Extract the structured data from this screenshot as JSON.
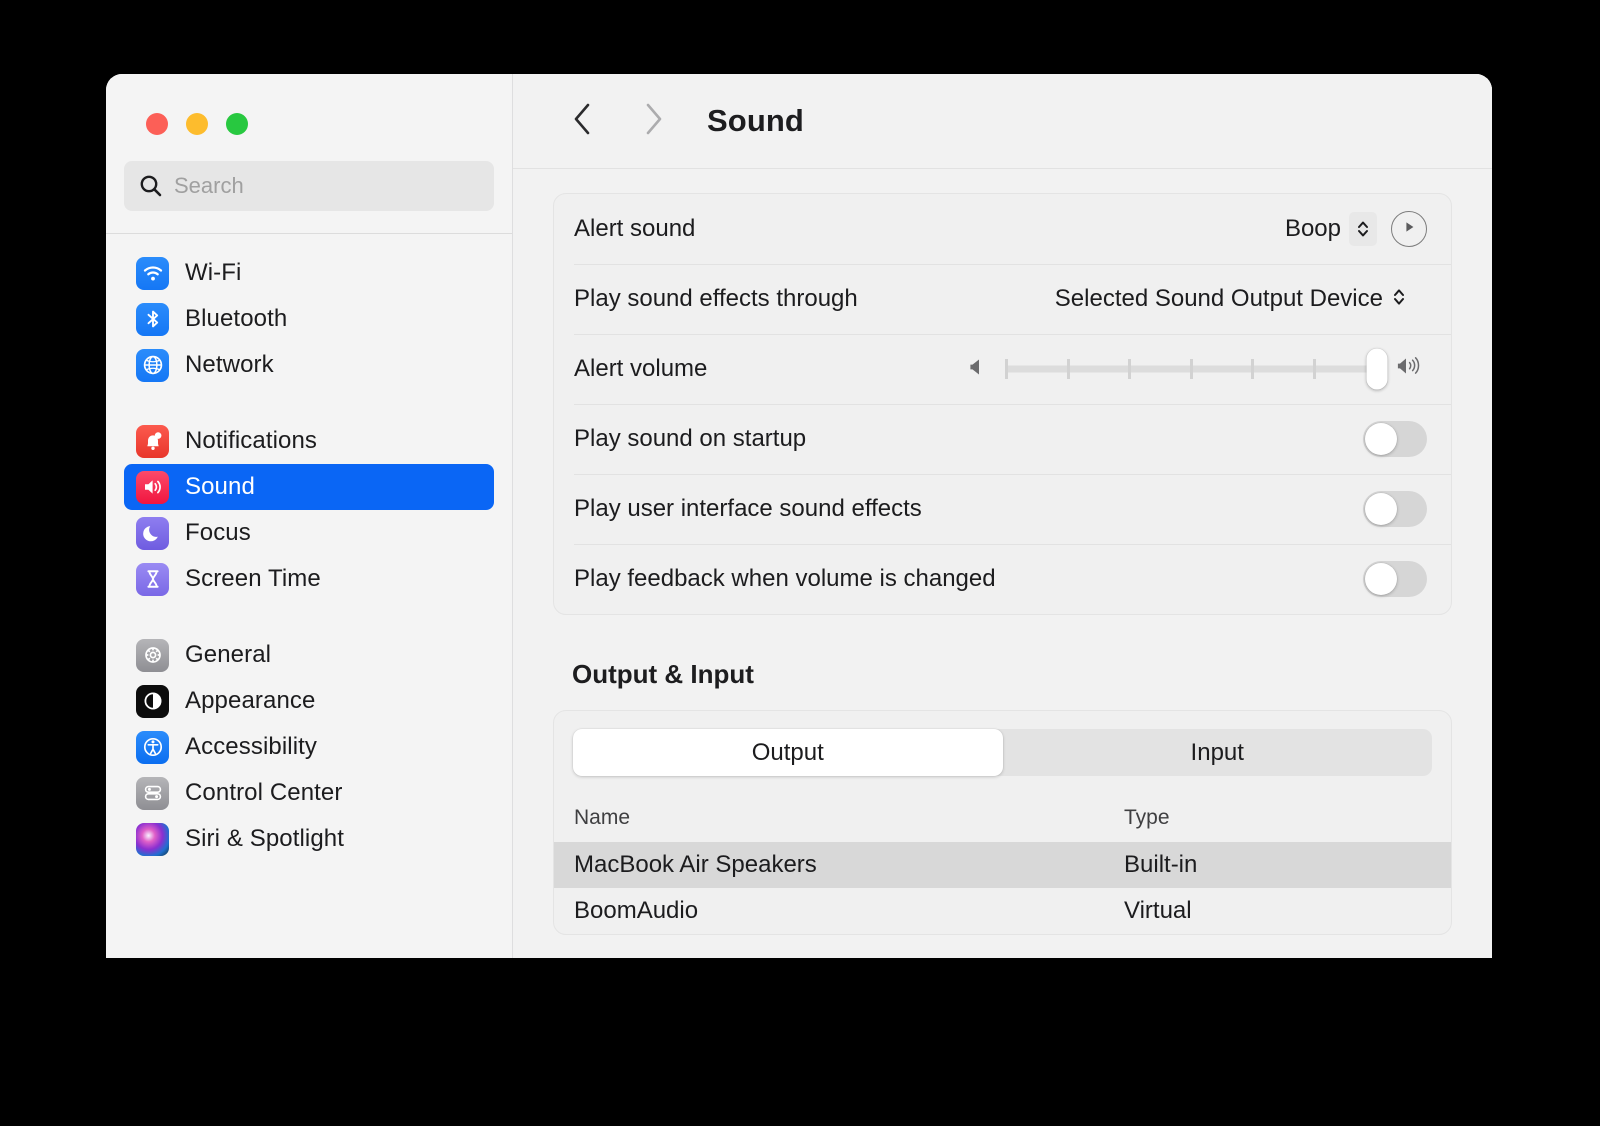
{
  "window": {
    "traffic_lights": [
      "close",
      "minimize",
      "zoom"
    ],
    "colors": {
      "close": "#fc5f57",
      "minimize": "#fdbc2d",
      "zoom": "#28c840",
      "accent": "#0a66f5"
    }
  },
  "sidebar": {
    "search": {
      "placeholder": "Search",
      "value": "",
      "icon": "search-icon"
    },
    "groups": [
      {
        "items": [
          {
            "label": "Wi-Fi",
            "icon": "wifi-icon",
            "selected": false
          },
          {
            "label": "Bluetooth",
            "icon": "bluetooth-icon",
            "selected": false
          },
          {
            "label": "Network",
            "icon": "network-globe-icon",
            "selected": false
          }
        ]
      },
      {
        "items": [
          {
            "label": "Notifications",
            "icon": "notifications-bell-icon",
            "selected": false
          },
          {
            "label": "Sound",
            "icon": "sound-speaker-icon",
            "selected": true
          },
          {
            "label": "Focus",
            "icon": "focus-moon-icon",
            "selected": false
          },
          {
            "label": "Screen Time",
            "icon": "screen-time-hourglass-icon",
            "selected": false
          }
        ]
      },
      {
        "items": [
          {
            "label": "General",
            "icon": "general-gear-icon",
            "selected": false
          },
          {
            "label": "Appearance",
            "icon": "appearance-contrast-icon",
            "selected": false
          },
          {
            "label": "Accessibility",
            "icon": "accessibility-icon",
            "selected": false
          },
          {
            "label": "Control Center",
            "icon": "control-center-toggles-icon",
            "selected": false
          },
          {
            "label": "Siri & Spotlight",
            "icon": "siri-orb-icon",
            "selected": false
          }
        ]
      }
    ]
  },
  "toolbar": {
    "back_icon": "chevron-left-icon",
    "forward_icon": "chevron-right-icon",
    "title": "Sound"
  },
  "main": {
    "alert_sound": {
      "label": "Alert sound",
      "value": "Boop",
      "stepper_icon": "chevron-up-down-icon",
      "play_icon": "play-icon"
    },
    "play_sound_effects_through": {
      "label": "Play sound effects through",
      "value": "Selected Sound Output Device",
      "stepper_icon": "chevron-up-down-icon"
    },
    "alert_volume": {
      "label": "Alert volume",
      "min_icon": "speaker-low-icon",
      "max_icon": "speaker-high-icon",
      "value": 100,
      "min": 0,
      "max": 100,
      "tick_count": 7
    },
    "toggles": [
      {
        "label": "Play sound on startup",
        "on": false
      },
      {
        "label": "Play user interface sound effects",
        "on": false
      },
      {
        "label": "Play feedback when volume is changed",
        "on": false
      }
    ],
    "output_input": {
      "section_title": "Output & Input",
      "segments": [
        {
          "label": "Output",
          "active": true
        },
        {
          "label": "Input",
          "active": false
        }
      ],
      "table": {
        "columns": [
          "Name",
          "Type"
        ],
        "rows": [
          {
            "name": "MacBook Air Speakers",
            "type": "Built-in",
            "selected": true
          },
          {
            "name": "BoomAudio",
            "type": "Virtual",
            "selected": false
          }
        ]
      }
    }
  }
}
